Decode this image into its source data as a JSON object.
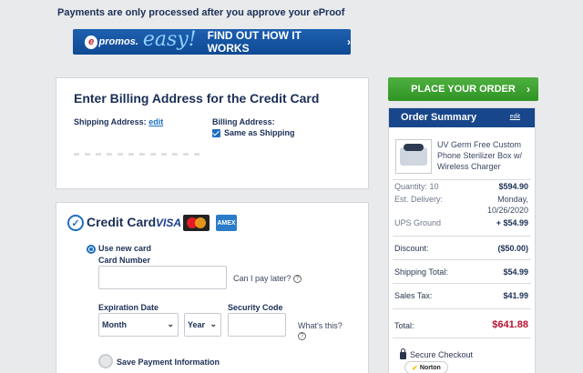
{
  "top_notice": "Payments are only processed after you approve your eProof",
  "banner": {
    "e": "e",
    "promos": "promos.",
    "easy": "easy!",
    "cta": "FIND OUT HOW IT WORKS",
    "arrow_icon": "chevron-right-icon"
  },
  "billing": {
    "title": "Enter Billing Address for the Credit Card",
    "shipping_label": "Shipping Address:",
    "shipping_edit": "edit",
    "billing_label": "Billing Address:",
    "same_as_shipping": "Same as Shipping",
    "same_checked": true
  },
  "credit_card": {
    "title": "Credit Card",
    "cards": {
      "visa": "VISA",
      "amex": "AMEX"
    },
    "use_new": "Use new card",
    "card_number_label": "Card Number",
    "card_number_value": "",
    "pay_later": "Can I pay later?",
    "expiration_label": "Expiration Date",
    "month": "Month",
    "year": "Year",
    "security_label": "Security Code",
    "security_value": "",
    "whats_this": "What's this?",
    "save_payment": "Save Payment Information"
  },
  "place_order": {
    "label": "PLACE YOUR ORDER",
    "arrow": "›"
  },
  "summary": {
    "title": "Order Summary",
    "edit": "edit",
    "product_name": "UV Germ Free Custom Phone Sterilizer Box w/ Wireless Charger",
    "quantity_label": "Quantity: 10",
    "quantity_price": "$594.90",
    "delivery_label": "Est. Delivery:",
    "delivery_day": "Monday,",
    "delivery_date": "10/26/2020",
    "shipping_method": "UPS Ground",
    "shipping_method_price": "+ $54.99",
    "discount_label": "Discount:",
    "discount_value": "($50.00)",
    "shipping_total_label": "Shipping Total:",
    "shipping_total_value": "$54.99",
    "tax_label": "Sales Tax:",
    "tax_value": "$41.99",
    "total_label": "Total:",
    "total_value": "$641.88",
    "secure": "Secure Checkout",
    "norton": "Norton"
  },
  "colors": {
    "accent": "#1d6fc0",
    "header_blue": "#18468a",
    "green": "#3aa02e",
    "total_red": "#b5122f"
  }
}
